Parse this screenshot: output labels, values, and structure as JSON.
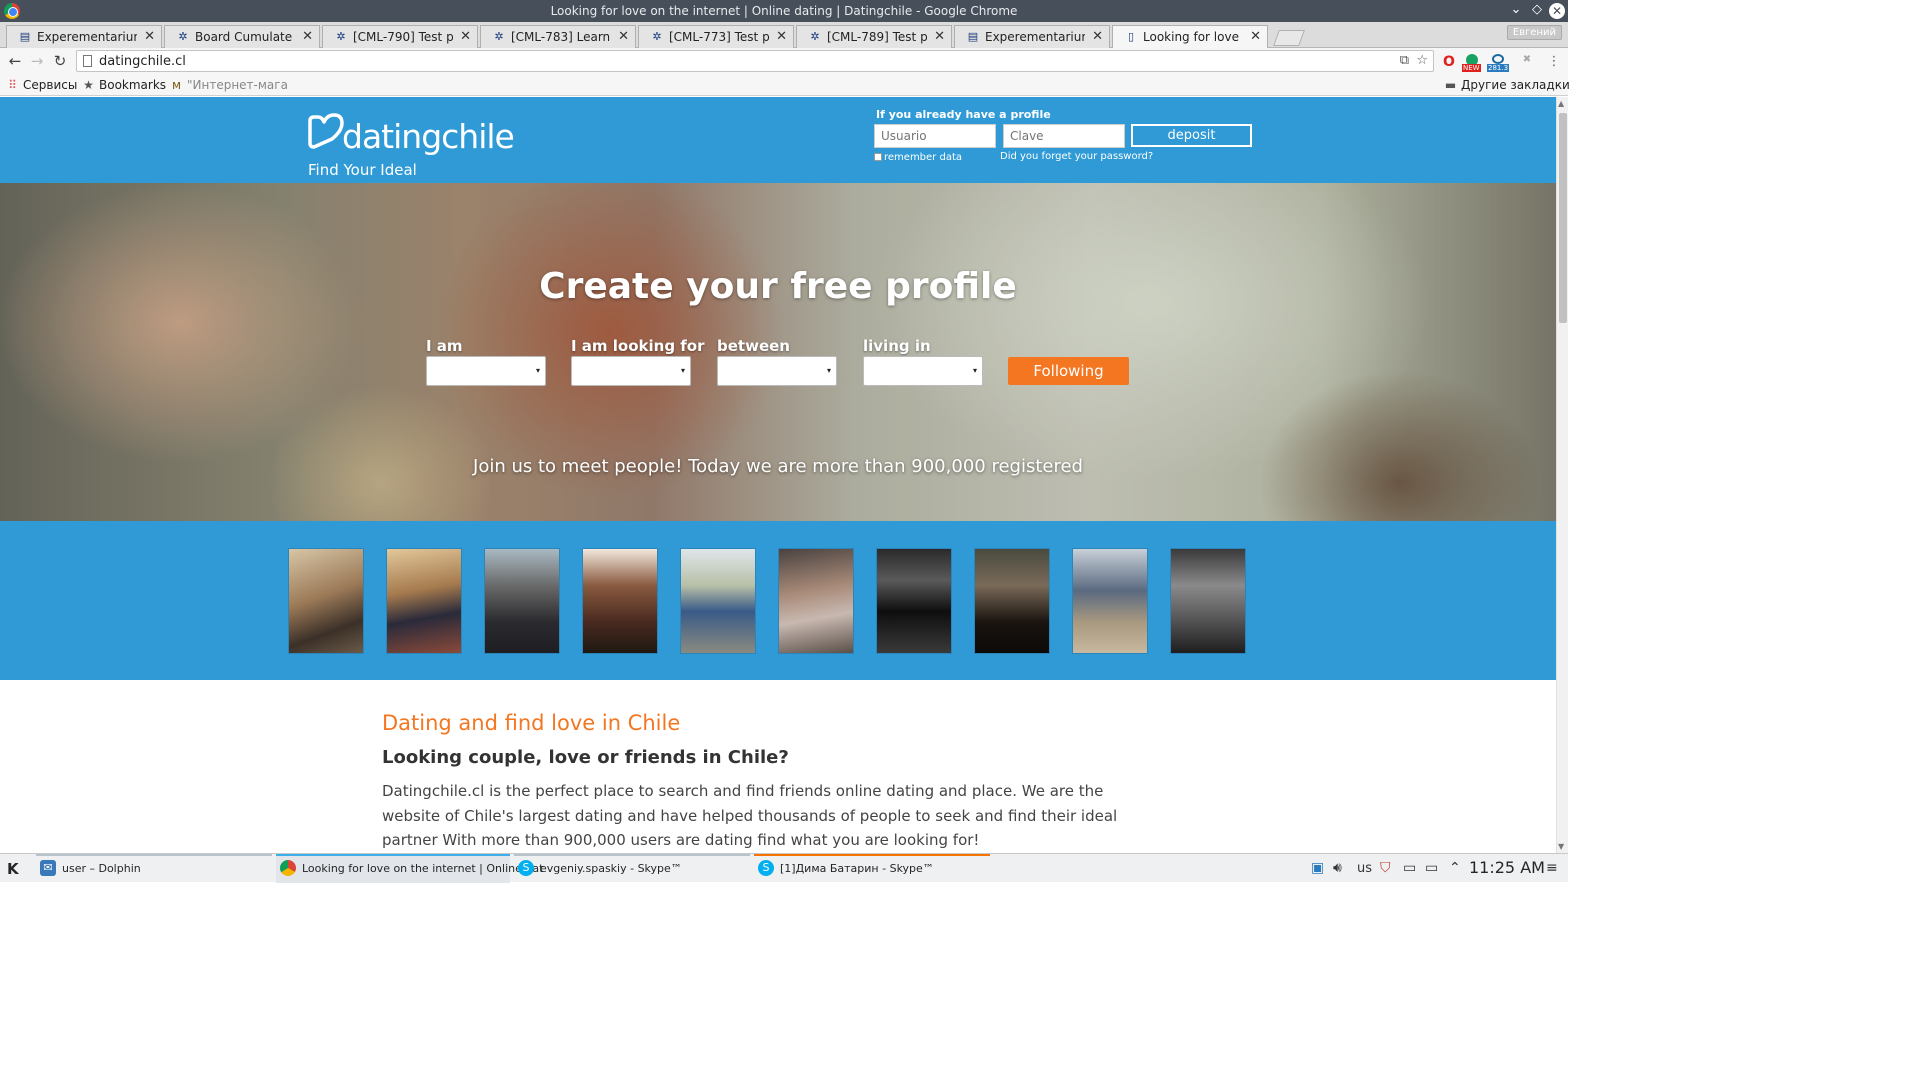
{
  "window": {
    "title": "Looking for love on the internet | Online dating | Datingchile - Google Chrome"
  },
  "tabs": [
    {
      "label": "Experementarium |",
      "icon": "doc-icon"
    },
    {
      "label": "Board Cumulate - A",
      "icon": "jira-icon"
    },
    {
      "label": "[CML-790] Test proje",
      "icon": "jira-icon"
    },
    {
      "label": "[CML-783] Learning",
      "icon": "jira-icon"
    },
    {
      "label": "[CML-773] Test proje",
      "icon": "jira-icon"
    },
    {
      "label": "[CML-789] Test proje",
      "icon": "jira-icon"
    },
    {
      "label": "Experementarium |",
      "icon": "doc-icon"
    },
    {
      "label": "Looking for love on",
      "icon": "page-icon"
    }
  ],
  "profile_badge": "Евгений",
  "toolbar": {
    "url": "datingchile.cl",
    "ext_badge_new": "NEW",
    "ext_badge_count": "281.3"
  },
  "bookmarks": {
    "apps": "Сервисы",
    "bookmarks": "Bookmarks",
    "shop": "\"Интернет-мага",
    "other": "Другие закладки"
  },
  "site": {
    "logo_text": "datingchile",
    "tagline": "Find Your Ideal",
    "login": {
      "heading": "If you already have a profile",
      "user_placeholder": "Usuario",
      "pass_placeholder": "Clave",
      "deposit": "deposit",
      "remember": "remember data",
      "forgot": "Did you forget your password?"
    },
    "hero": {
      "title": "Create your free profile",
      "fields": [
        {
          "label": "I am",
          "value": ""
        },
        {
          "label": "I am looking for",
          "value": ""
        },
        {
          "label": "between",
          "value": ""
        },
        {
          "label": "living in",
          "value": ""
        }
      ],
      "submit": "Following",
      "join": "Join us to meet people! Today we are more than 900,000 registered"
    },
    "members_count": 10,
    "content": {
      "heading": "Dating and find love in Chile",
      "subheading": "Looking couple, love or friends in Chile?",
      "paragraph": "Datingchile.cl is the perfect place to search and find friends online dating and place. We are the website of Chile's largest dating and have helped thousands of people to seek and find their ideal partner With more than 900,000 users are dating find what you are looking for!"
    },
    "colors": {
      "brand_blue": "#2f9ad6",
      "accent_orange": "#f47621"
    }
  },
  "taskbar": {
    "items": [
      {
        "label": "user – Dolphin",
        "icon": "dolphin-icon"
      },
      {
        "label": "Looking for love on the internet | Online dat",
        "icon": "chrome-icon"
      },
      {
        "label": "evgeniy.spaskiy - Skype™",
        "icon": "skype-icon"
      },
      {
        "label": "[1]Дима Батарин - Skype™",
        "icon": "skype-icon"
      }
    ],
    "keyboard_layout": "us",
    "clock": "11:25 AM"
  }
}
